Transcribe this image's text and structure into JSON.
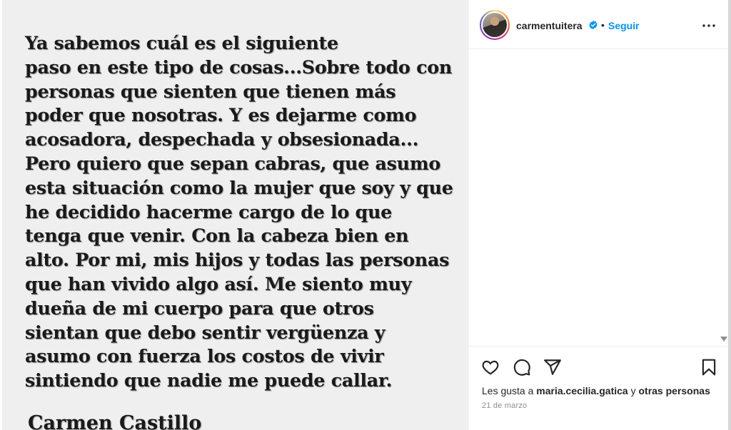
{
  "post": {
    "text": "Ya sabemos cuál es el siguiente\n paso en este tipo de cosas...Sobre todo con\npersonas que sienten que tienen más\npoder que nosotras. Y es dejarme como\nacosadora, despechada y obsesionada...\nPero quiero que sepan cabras, que asumo\nesta situación como la mujer que soy y que\nhe decidido hacerme cargo de lo que\ntenga que venir. Con la cabeza bien en\nalto. Por mi, mis hijos y todas las personas\nque han vivido algo así. Me siento muy\ndueña de mi cuerpo para que otros\nsientan que debo sentir vergüenza y\nasumo con fuerza los costos de vivir\nsintiendo  que nadie me puede callar.",
    "signature": "Carmen Castillo"
  },
  "header": {
    "username": "carmentuitera",
    "separator": "•",
    "follow_label": "Seguir",
    "icons": {
      "verified": "verified-badge-icon",
      "more": "more-options-icon"
    },
    "colors": {
      "follow": "#0095f6",
      "verified": "#0095f6"
    }
  },
  "actions": {
    "icons": [
      "heart-icon",
      "comment-icon",
      "share-icon",
      "bookmark-icon"
    ],
    "likes_prefix": "Les gusta a ",
    "likes_user": "maria.cecilia.gatica",
    "likes_middle": " y ",
    "likes_suffix": "otras personas",
    "date": "21 de marzo"
  }
}
